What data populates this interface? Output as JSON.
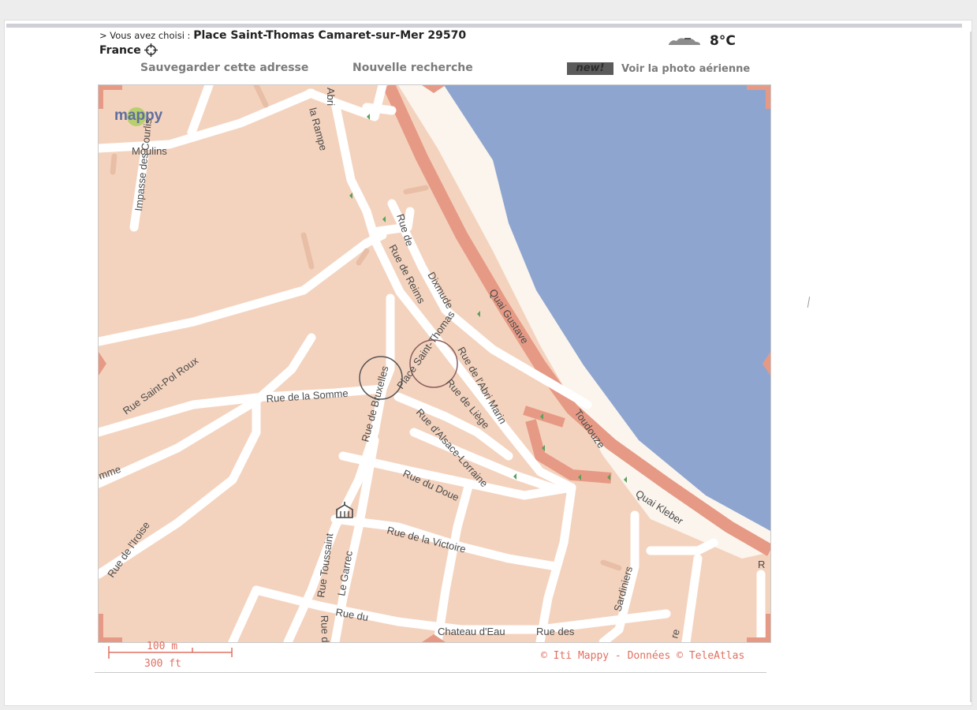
{
  "header": {
    "prefix": "> Vous avez choisi :",
    "place": "Place Saint-Thomas Camaret-sur-Mer 29570",
    "country": "France"
  },
  "weather": {
    "temperature": "8°C",
    "icon": "cloud-icon"
  },
  "links": {
    "save": "Sauvegarder cette adresse",
    "new_search": "Nouvelle recherche",
    "new_badge": "new!",
    "aerial": "Voir la photo aérienne"
  },
  "map": {
    "logo": "mappy",
    "colors": {
      "land": "#f4d3be",
      "water": "#8ea6cf",
      "beach": "#fbf5ee",
      "street": "#ffffff",
      "main_road": "#e69a85",
      "accent": "#e07060"
    },
    "labels": {
      "moulins": "Moulins",
      "impasse": "Impasse des Courlis",
      "rampe": "la Rampe",
      "abri": "Abri",
      "rue_de": "Rue de",
      "dixmude": "Dixmude",
      "reims": "Rue de Reims",
      "quai_gustave": "Quai Gustave",
      "toudouze": "Toudouze",
      "quai_kleber": "Quai Kleber",
      "saint_pol": "Rue Saint-Pol Roux",
      "somme": "Rue de la Somme",
      "bruxelles": "Rue de Bruxelles",
      "place_st": "Place Saint-Thomas",
      "marin": "Rue de l'Abri Marin",
      "liege": "Rue de Liège",
      "alsace": "Rue d'Alsace-Lorraine",
      "doue": "Rue du Doue",
      "victoire": "Rue de la Victoire",
      "iroise": "Rue de l'Iroise",
      "toussaint": "Rue Toussaint",
      "garrec": "Le Garrec",
      "rue_du": "Rue du",
      "chateau": "Chateau d'Eau",
      "rue_des": "Rue des",
      "sardiniers": "Sardiniers",
      "mme": "mme",
      "rue_c": "Rue d",
      "r": "R",
      "re": "re"
    }
  },
  "scale": {
    "metric": "100 m",
    "imperial": "300 ft"
  },
  "copyright": "© Iti Mappy - Données © TeleAtlas"
}
